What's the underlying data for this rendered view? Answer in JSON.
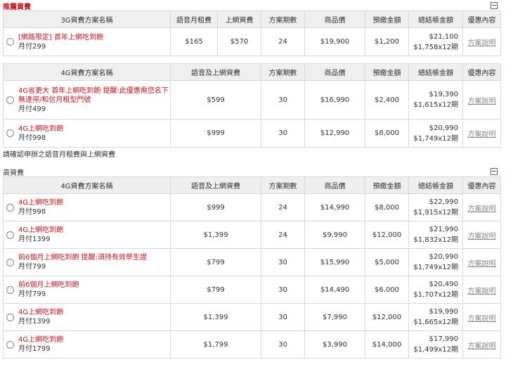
{
  "recommended": {
    "title": "推薦資費",
    "headers": [
      "3G資費方案名稱",
      "語音月租費",
      "上網資費",
      "方案期數",
      "商品價",
      "預繳金額",
      "總結帳金額",
      "優惠內容"
    ],
    "rows": [
      {
        "name": "[網路限定] 首年上網吃到飽",
        "fee": "月付299",
        "c1": "$165",
        "c2": "$570",
        "term": "24",
        "price": "$19,900",
        "prepay": "$1,200",
        "total1": "$21,100",
        "total2": "$1,758x12期",
        "link": "方案說明"
      }
    ]
  },
  "table2": {
    "headers": [
      "4G資費方案名稱",
      "語音及上網資費",
      "方案期數",
      "商品價",
      "預繳金額",
      "總結帳金額",
      "優惠內容"
    ],
    "rows": [
      {
        "name": "4G省更大 首年上網吃到飽 提醒:此優惠需您名下無違停/和信月租型門號",
        "fee": "月付499",
        "c1": "$599",
        "term": "30",
        "price": "$16,990",
        "prepay": "$2,400",
        "total1": "$19,390",
        "total2": "$1,615x12期",
        "link": "方案說明"
      },
      {
        "name": "4G上網吃到飽",
        "fee": "月付998",
        "c1": "$999",
        "term": "30",
        "price": "$12,990",
        "prepay": "$8,000",
        "total1": "$20,990",
        "total2": "$1,749x12期",
        "link": "方案說明"
      }
    ]
  },
  "notice": "請確認申辦之語音月租費與上網資費",
  "high": {
    "title": "高資費",
    "headers": [
      "4G資費方案名稱",
      "語音及上網資費",
      "方案期數",
      "商品價",
      "預繳金額",
      "總結帳金額",
      "優惠內容"
    ],
    "rows": [
      {
        "name": "4G上網吃到飽",
        "fee": "月付998",
        "c1": "$999",
        "term": "24",
        "price": "$14,990",
        "prepay": "$8,000",
        "total1": "$22,990",
        "total2": "$1,915x12期",
        "link": "方案說明"
      },
      {
        "name": "4G上網吃到飽",
        "fee": "月付1399",
        "c1": "$1,399",
        "term": "24",
        "price": "$9,990",
        "prepay": "$12,000",
        "total1": "$21,990",
        "total2": "$1,832x12期",
        "link": "方案說明"
      },
      {
        "name": "前6個月上網吃到飽 提醒:須持有效學生證",
        "fee": "月付799",
        "c1": "$799",
        "term": "30",
        "price": "$15,990",
        "prepay": "$5,000",
        "total1": "$20,990",
        "total2": "$1,749x12期",
        "link": "方案說明"
      },
      {
        "name": "前6個月上網吃到飽",
        "fee": "月付799",
        "c1": "$799",
        "term": "30",
        "price": "$14,490",
        "prepay": "$6,000",
        "total1": "$20,490",
        "total2": "$1,707x12期",
        "link": "方案說明"
      },
      {
        "name": "4G上網吃到飽",
        "fee": "月付1399",
        "c1": "$1,399",
        "term": "30",
        "price": "$7,990",
        "prepay": "$12,000",
        "total1": "$19,990",
        "total2": "$1,665x12期",
        "link": "方案說明"
      },
      {
        "name": "4G上網吃到飽",
        "fee": "月付1799",
        "c1": "$1,799",
        "term": "30",
        "price": "$3,990",
        "prepay": "$14,000",
        "total1": "$17,990",
        "total2": "$1,499x12期",
        "link": "方案說明"
      }
    ]
  }
}
